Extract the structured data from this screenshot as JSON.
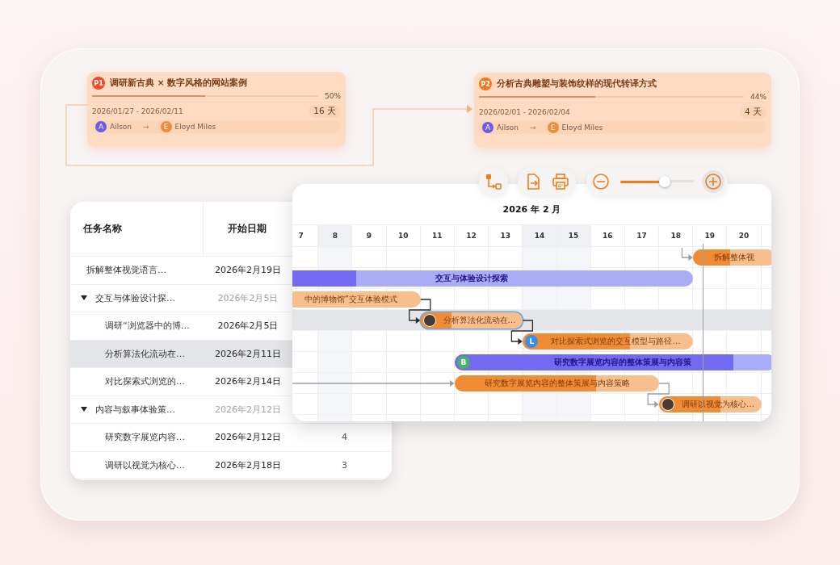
{
  "cards": [
    {
      "badge": "P1",
      "color": "#ef4b2c",
      "title": "调研新古典 × 数字风格的网站案例",
      "level": 0.5,
      "percent": "50%",
      "dates": "2026/01/27 - 2026/02/11",
      "duration": "16 天",
      "from": {
        "letter": "A",
        "name": "Ailson"
      },
      "arrow": "→",
      "to": {
        "letter": "E",
        "name": "Eloyd Miles"
      }
    },
    {
      "badge": "P2",
      "color": "#f5781e",
      "title": "分析古典雕塑与装饰纹样的现代转译方式",
      "level": 0.44,
      "percent": "44%",
      "dates": "2026/02/01 - 2026/02/04",
      "duration": "4 天",
      "from": {
        "letter": "A",
        "name": "Ailson"
      },
      "arrow": "→",
      "to": {
        "letter": "E",
        "name": "Eloyd Miles"
      }
    }
  ],
  "toolbar": {
    "zoom": {
      "level": 0.6
    }
  },
  "table": {
    "columns": [
      "任务名称",
      "开始日期"
    ],
    "rows": [
      {
        "name": "拆解整体视觉语言…",
        "start": "2026年2月19日",
        "selected": false
      },
      {
        "name": "交互与体验设计探…",
        "start": "2026年2月5日",
        "expanded": true,
        "selected": false,
        "children": [
          {
            "name": "调研“浏览器中的博…",
            "start": "2026年2月5日",
            "selected": false
          },
          {
            "name": "分析算法化流动在…",
            "start": "2026年2月11日",
            "selected": true
          },
          {
            "name": "对比探索式浏览的…",
            "start": "2026年2月14日",
            "selected": false
          }
        ]
      },
      {
        "name": "内容与叙事体验策…",
        "start": "2026年2月12日",
        "expanded": true,
        "selected": false,
        "children": [
          {
            "name": "研究数字展览内容…",
            "start": "2026年2月12日",
            "column_3": "4",
            "selected": false
          },
          {
            "name": "调研以视觉为核心…",
            "start": "2026年2月18日",
            "column_3": "3",
            "selected": false
          }
        ]
      }
    ]
  },
  "gantt": {
    "title": "2026 年 2 月",
    "days": [
      {
        "label": "7",
        "shaded": false
      },
      {
        "label": "8",
        "shaded": true
      },
      {
        "label": "9",
        "shaded": false
      },
      {
        "label": "10",
        "shaded": false
      },
      {
        "label": "11",
        "shaded": false
      },
      {
        "label": "12",
        "shaded": false
      },
      {
        "label": "13",
        "shaded": false
      },
      {
        "label": "14",
        "shaded": true
      },
      {
        "label": "15",
        "shaded": true
      },
      {
        "label": "16",
        "shaded": false
      },
      {
        "label": "17",
        "shaded": false
      },
      {
        "label": "18",
        "shaded": false
      },
      {
        "label": "19",
        "shaded": false
      },
      {
        "label": "20",
        "shaded": false
      }
    ],
    "bars": [
      {
        "label": "拆解整体视",
        "kind": "task",
        "level": 0.45,
        "selected": false
      },
      {
        "label": "交互与体验设计探索",
        "kind": "summary",
        "level": 0.24,
        "selected": false
      },
      {
        "label": "中的博物馆”交互体验模式",
        "kind": "task",
        "selected": false
      },
      {
        "label": "分析算法化流动在…",
        "kind": "task",
        "level": 0.3,
        "selected": true,
        "avatar": {
          "kind": "photo"
        }
      },
      {
        "label": "对比探索式浏览的交互模型与路径…",
        "kind": "task",
        "level": 0.63,
        "selected": false,
        "avatar": {
          "kind": "letter",
          "letter": "L",
          "color": "#3b8ee6"
        }
      },
      {
        "label": "研究数字展览内容的整体策展与内容策",
        "kind": "summary",
        "level": 0.87,
        "selected": false,
        "avatar": {
          "kind": "letter",
          "letter": "B",
          "color": "#4caf6a"
        }
      },
      {
        "label": "研究数字展览内容的整体策展与内容策略",
        "kind": "task",
        "level": 0.69,
        "selected": false
      },
      {
        "label": "调研以视觉为核心…",
        "kind": "task",
        "level": 0.6,
        "selected": false,
        "avatar": {
          "kind": "photo"
        }
      }
    ]
  }
}
